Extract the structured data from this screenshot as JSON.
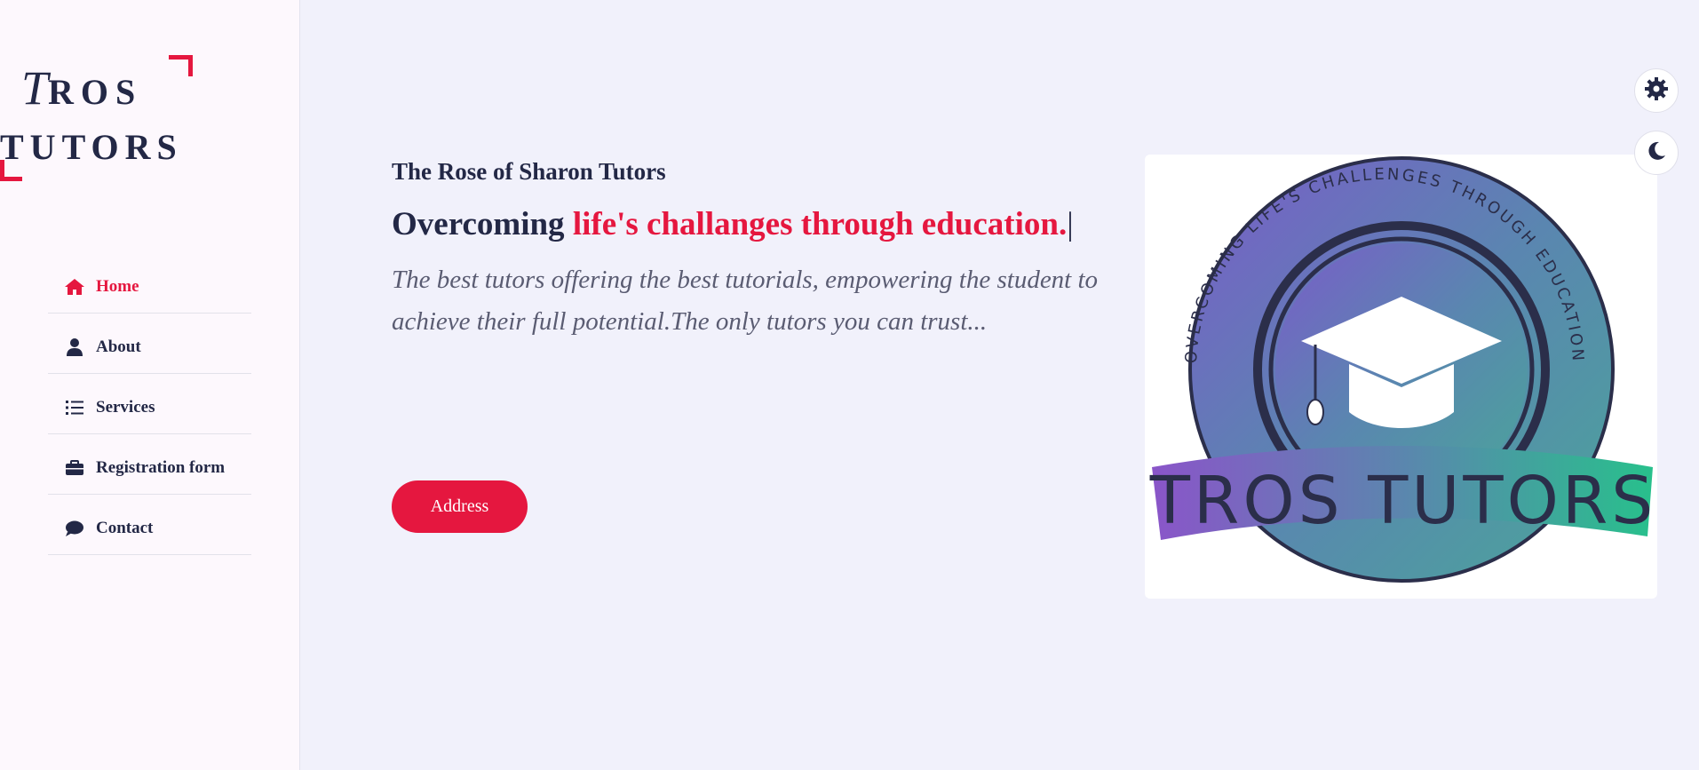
{
  "brand": {
    "line1_initial": "T",
    "line1_rest": "ROS",
    "line2": "TUTORS"
  },
  "nav": [
    {
      "label": "Home",
      "icon": "home-icon",
      "active": true
    },
    {
      "label": "About",
      "icon": "user-icon",
      "active": false
    },
    {
      "label": "Services",
      "icon": "list-icon",
      "active": false
    },
    {
      "label": "Registration form",
      "icon": "briefcase-icon",
      "active": false
    },
    {
      "label": "Contact",
      "icon": "chat-bubble-icon",
      "active": false
    }
  ],
  "hero": {
    "subtitle": "The Rose of Sharon Tutors",
    "headline_prefix": "Overcoming ",
    "headline_accent": "life's challanges through education.",
    "caret": "|",
    "description": "The best tutors offering the best tutorials, empowering the student to achieve their full potential.The only tutors you can trust...",
    "address_button": "Address"
  },
  "badge": {
    "arc_text": "OVERCOMING LIFE'S CHALLENGES THROUGH EDUCATION",
    "banner_text": "TROS TUTORS"
  },
  "colors": {
    "accent": "#e5173f",
    "dark": "#232846",
    "background": "#f1f1fb",
    "sidebar": "#fdf8fd"
  }
}
